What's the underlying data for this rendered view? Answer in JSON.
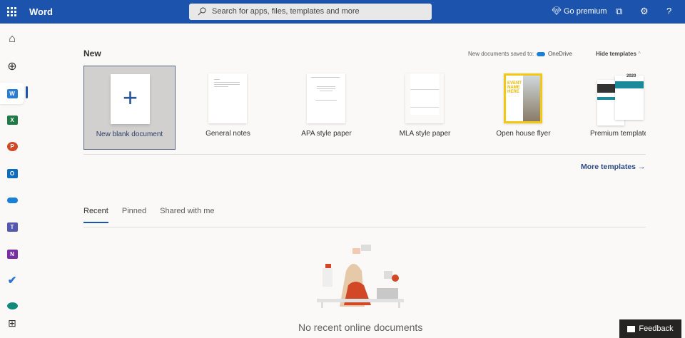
{
  "header": {
    "app_name": "Word",
    "search_placeholder": "Search for apps, files, templates and more",
    "premium": "Go premium",
    "help": "?"
  },
  "sidebar": {
    "items": [
      "Home",
      "Create",
      "Word",
      "Excel",
      "PowerPoint",
      "Outlook",
      "OneDrive",
      "Teams",
      "OneNote",
      "To Do",
      "Family Safety",
      "Apps"
    ]
  },
  "new_section": {
    "title": "New",
    "saved_to_label": "New documents saved to:",
    "saved_to": "OneDrive",
    "hide_templates": "Hide templates",
    "templates": [
      {
        "label": "New blank document"
      },
      {
        "label": "General notes"
      },
      {
        "label": "APA style paper"
      },
      {
        "label": "MLA style paper"
      },
      {
        "label": "Open house flyer"
      },
      {
        "label": "Premium templates"
      }
    ],
    "flyer_text": "EVENT NAME HERE",
    "premium_year": "2020",
    "more_templates": "More templates"
  },
  "tabs": [
    {
      "label": "Recent",
      "active": true
    },
    {
      "label": "Pinned"
    },
    {
      "label": "Shared with me"
    }
  ],
  "empty_state": "No recent online documents",
  "feedback": "Feedback",
  "colors": {
    "brand": "#1b53ad"
  }
}
